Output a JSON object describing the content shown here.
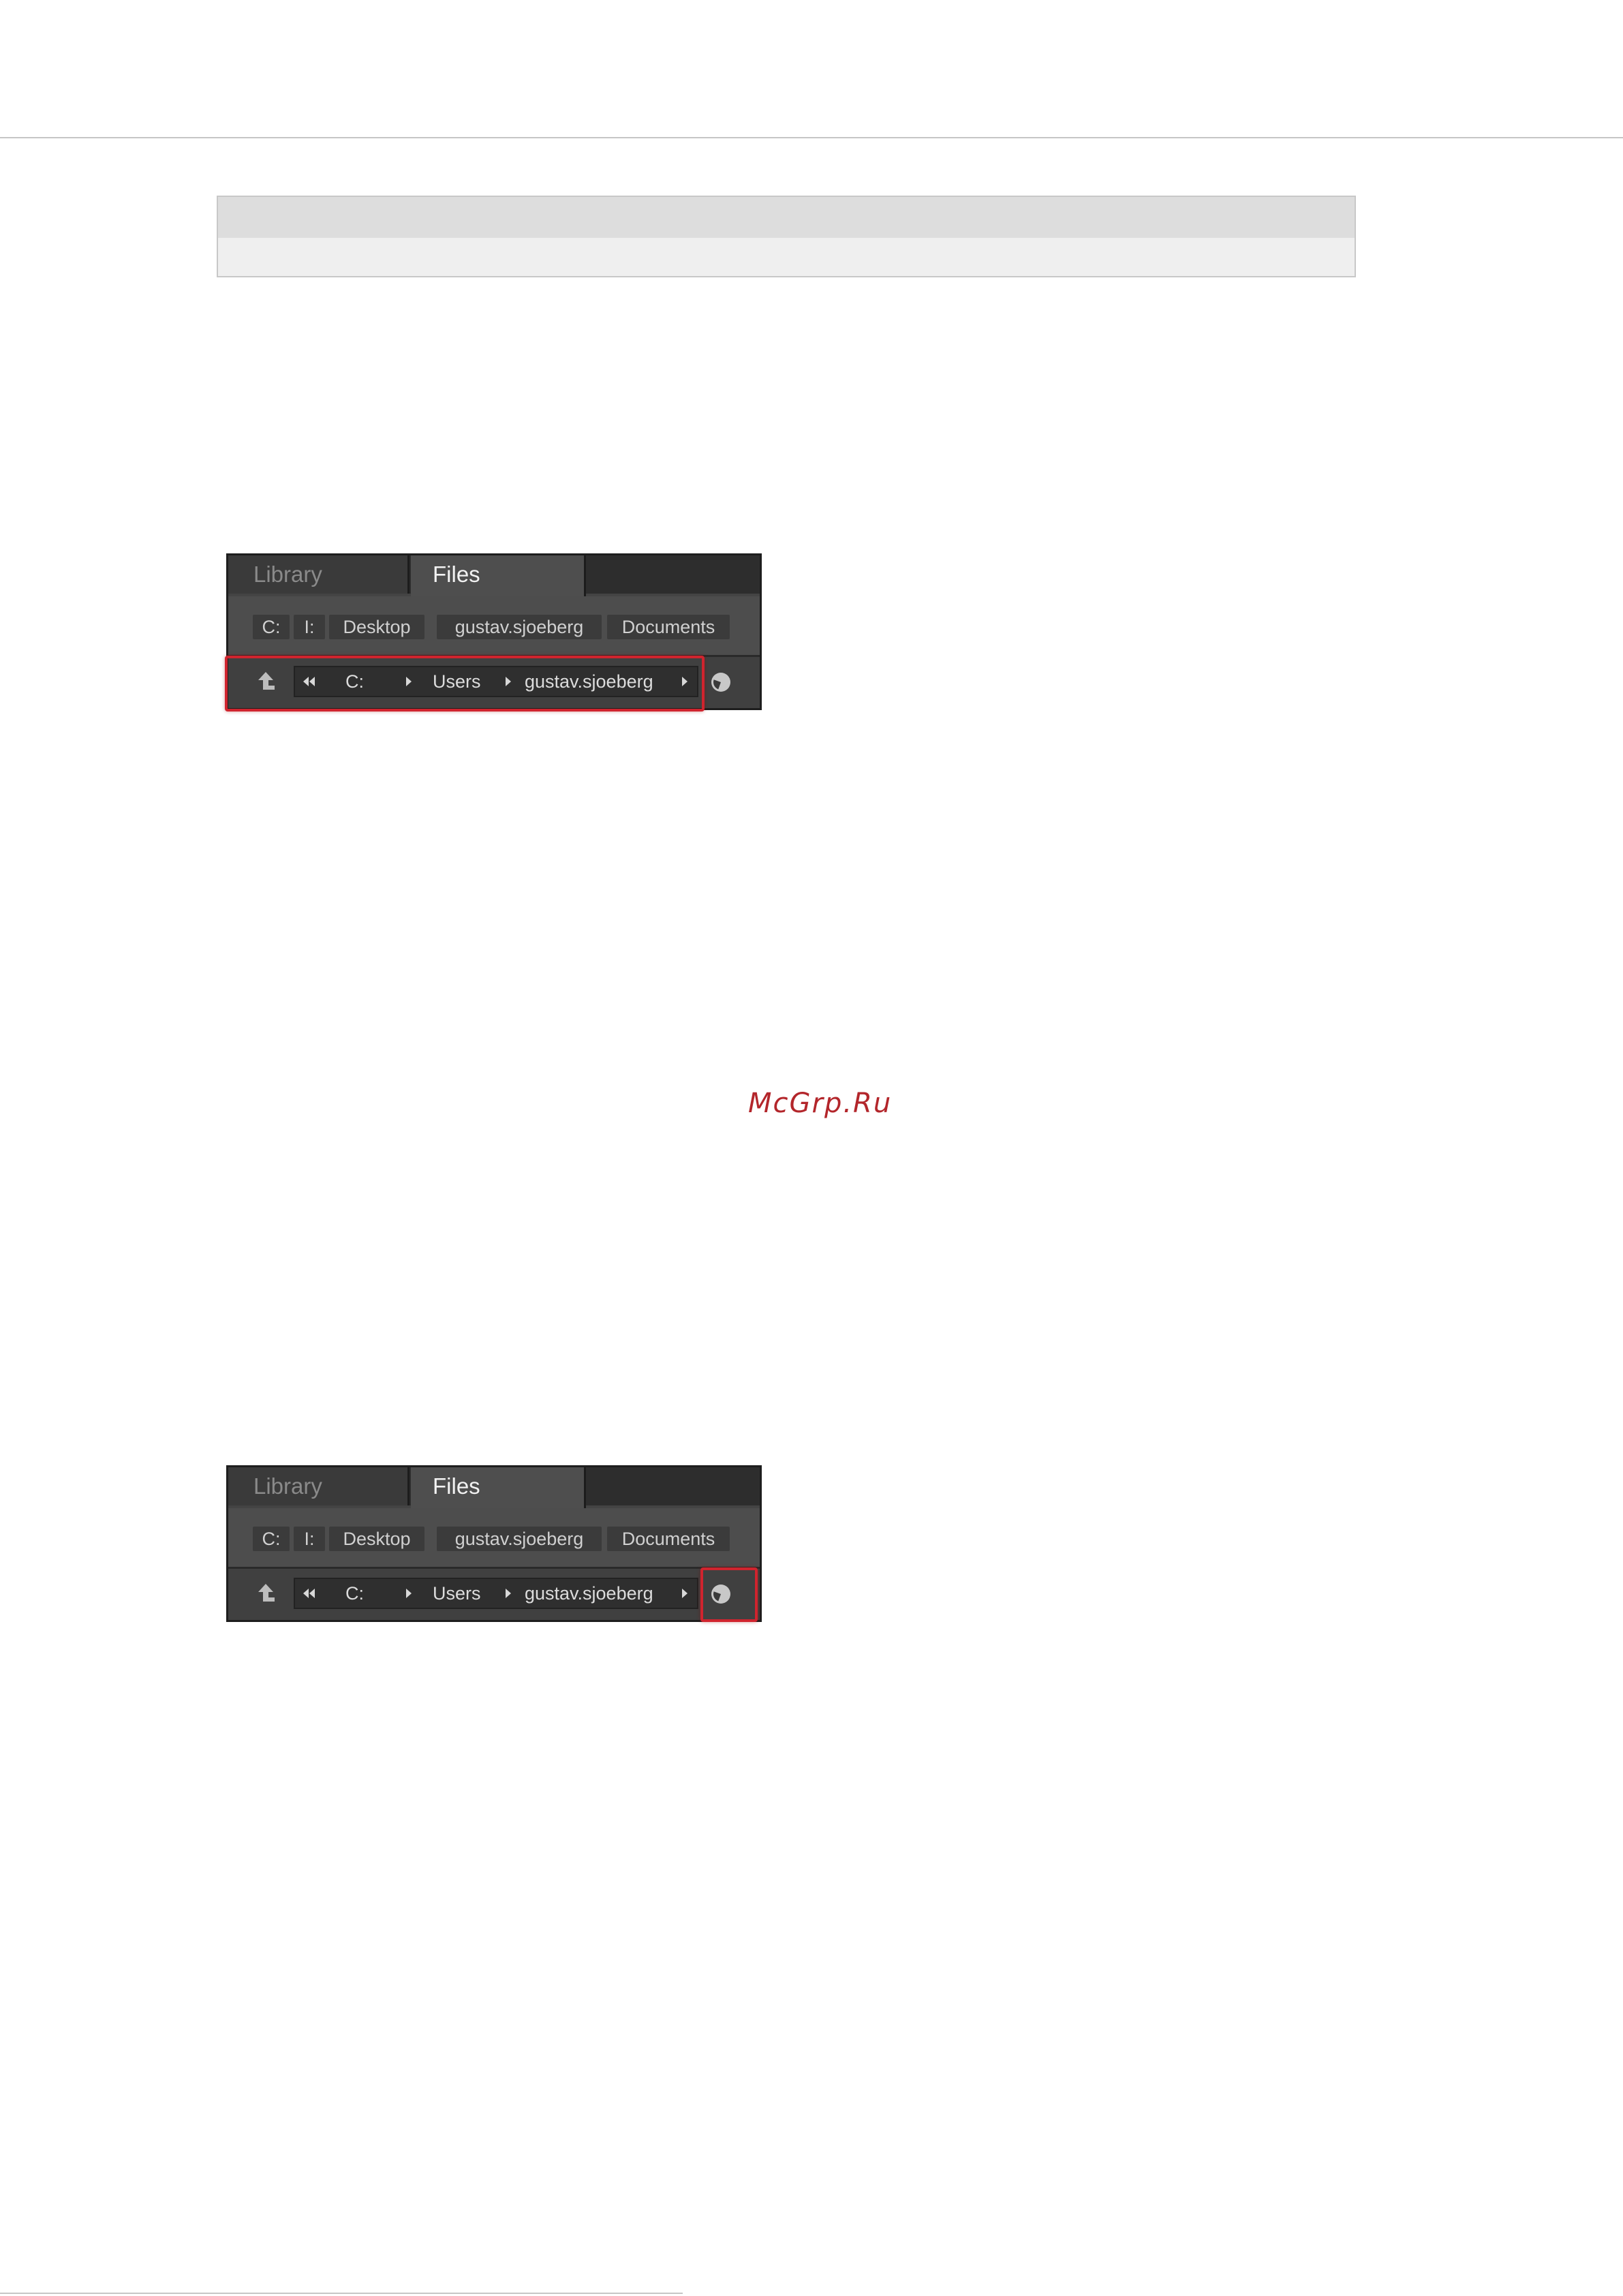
{
  "watermark": "McGrp.Ru",
  "browser_panels": [
    {
      "tabs": {
        "library": "Library",
        "files": "Files"
      },
      "favorites": [
        "C:",
        "I:",
        "Desktop",
        "gustav.sjoeberg",
        "Documents"
      ],
      "path": {
        "segments": [
          "C:",
          "Users",
          "gustav.sjoeberg"
        ]
      },
      "highlighted": "path-bar"
    },
    {
      "tabs": {
        "library": "Library",
        "files": "Files"
      },
      "favorites": [
        "C:",
        "I:",
        "Desktop",
        "gustav.sjoeberg",
        "Documents"
      ],
      "path": {
        "segments": [
          "C:",
          "Users",
          "gustav.sjoeberg"
        ]
      },
      "highlighted": "recent-locations-button"
    }
  ],
  "colors": {
    "highlight": "#d0242e",
    "watermark": "#b3262b",
    "panel_bg": "#444444"
  },
  "icons": [
    "up-arrow-icon",
    "double-left-arrow-icon",
    "right-triangle-icon",
    "clock-icon"
  ]
}
